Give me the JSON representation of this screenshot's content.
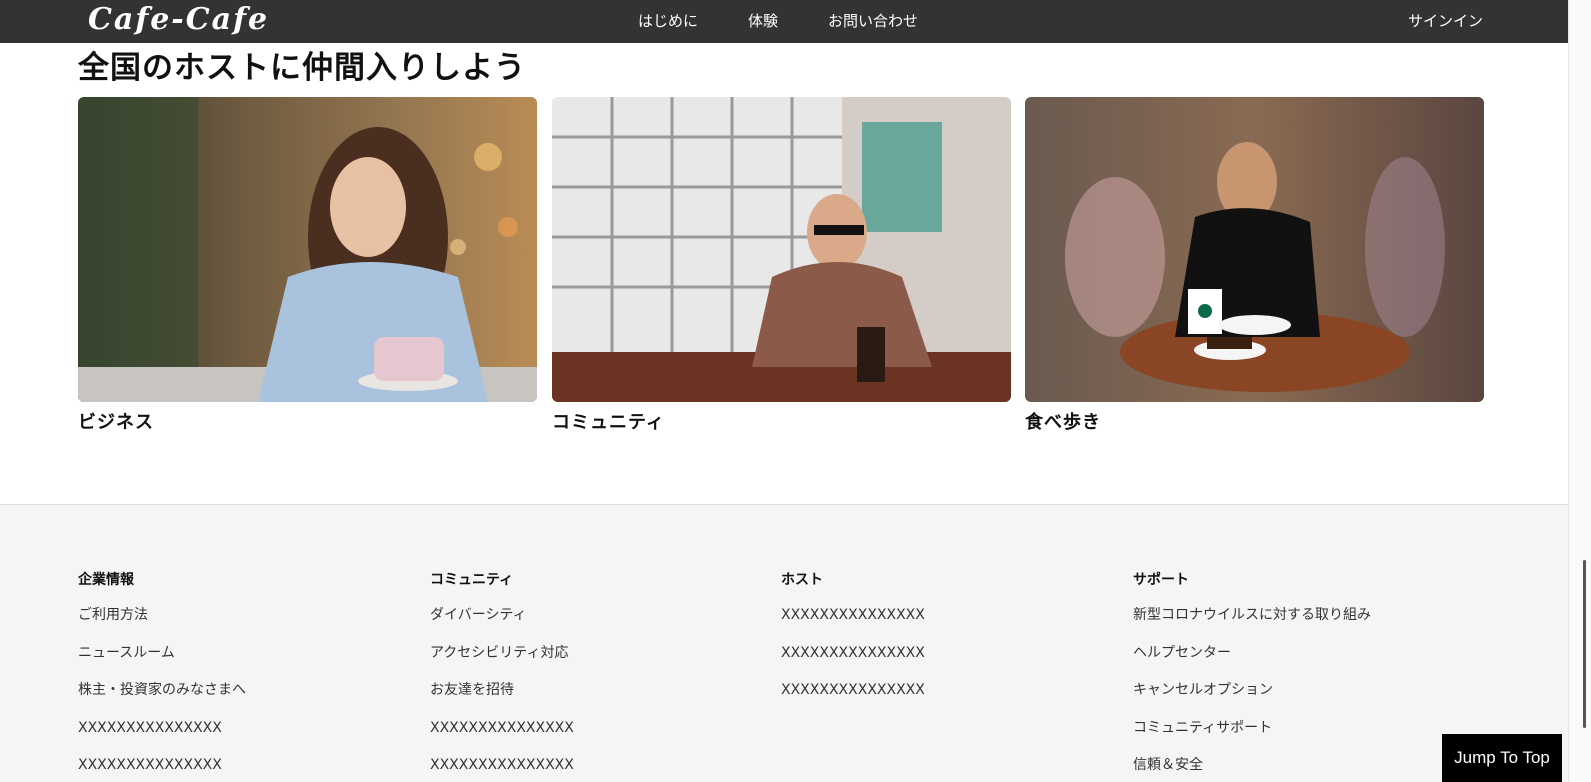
{
  "header": {
    "logo": "Cafe-Cafe",
    "nav": [
      "はじめに",
      "体験",
      "お問い合わせ"
    ],
    "signin": "サインイン"
  },
  "main": {
    "title": "全国のホストに仲間入りしよう",
    "cards": [
      {
        "label": "ビジネス",
        "photo_icon": "woman-on-phone-cafe-photo"
      },
      {
        "label": "コミュニティ",
        "photo_icon": "man-sunglasses-cafe-photo"
      },
      {
        "label": "食べ歩き",
        "photo_icon": "woman-eating-cafe-photo"
      }
    ]
  },
  "footer": {
    "columns": [
      {
        "heading": "企業情報",
        "links": [
          "ご利用方法",
          "ニュースルーム",
          "株主・投資家のみなさまへ",
          "XXXXXXXXXXXXXXX",
          "XXXXXXXXXXXXXXX"
        ]
      },
      {
        "heading": "コミュニティ",
        "links": [
          "ダイバーシティ",
          "アクセシビリティ対応",
          "お友達を招待",
          "XXXXXXXXXXXXXXX",
          "XXXXXXXXXXXXXXX"
        ]
      },
      {
        "heading": "ホスト",
        "links": [
          "XXXXXXXXXXXXXXX",
          "XXXXXXXXXXXXXXX",
          "XXXXXXXXXXXXXXX"
        ]
      },
      {
        "heading": "サポート",
        "links": [
          "新型コロナウイルスに対する取り組み",
          "ヘルプセンター",
          "キャンセルオプション",
          "コミュニティサポート",
          "信頼＆安全"
        ]
      }
    ]
  },
  "jump_to_top": "Jump To Top",
  "colors": {
    "header_bg": "#333333",
    "footer_bg": "#f5f5f5",
    "jump_bg": "#000000"
  }
}
